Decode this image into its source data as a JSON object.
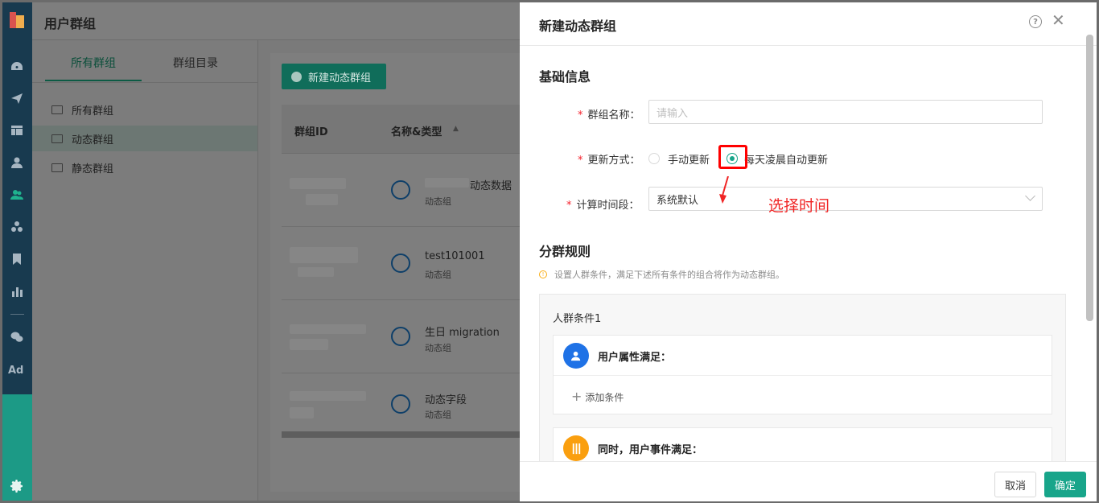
{
  "app": {
    "title": "用户群组",
    "rail_icons": [
      "dashboard-icon",
      "send-icon",
      "layout-icon",
      "user-icon",
      "group-icon",
      "cluster-icon",
      "bookmark-icon",
      "bar-chart-icon",
      "wechat-icon",
      "settings-icon"
    ],
    "rail_ad": "Ad"
  },
  "sidebar": {
    "tabs": [
      {
        "label": "所有群组"
      },
      {
        "label": "群组目录"
      }
    ],
    "items": [
      {
        "label": "所有群组"
      },
      {
        "label": "动态群组"
      },
      {
        "label": "静态群组"
      }
    ]
  },
  "content": {
    "new_button": "新建动态群组",
    "columns": [
      "群组ID",
      "名称&类型"
    ],
    "rows": [
      {
        "name": "动态数据",
        "type": "动态组"
      },
      {
        "name": "test101001",
        "type": "动态组"
      },
      {
        "name": "生日 migration",
        "type": "动态组"
      },
      {
        "name": "动态字段",
        "type": "动态组"
      }
    ]
  },
  "drawer": {
    "title": "新建动态群组",
    "help": "?",
    "close": "✕",
    "basic_section": "基础信息",
    "fields": {
      "name_label": "群组名称：",
      "name_placeholder": "请输入",
      "update_label": "更新方式：",
      "update_options": [
        {
          "label": "手动更新",
          "checked": false
        },
        {
          "label": "每天凌晨自动更新",
          "checked": true
        }
      ],
      "time_label": "计算时间段：",
      "time_value": "系统默认"
    },
    "annotation": "选择时间",
    "rules_section": "分群规则",
    "rules_hint": "设置人群条件，满足下述所有条件的组合将作为动态群组。",
    "group": {
      "title": "人群条件1",
      "attr_title": "用户属性满足：",
      "add_condition": "添加条件",
      "event_title": "同时，用户事件满足："
    },
    "cancel": "取消",
    "confirm": "确定"
  },
  "colors": {
    "accent": "#18a58a",
    "annotation": "#f02525",
    "rail": "#183a4f"
  }
}
